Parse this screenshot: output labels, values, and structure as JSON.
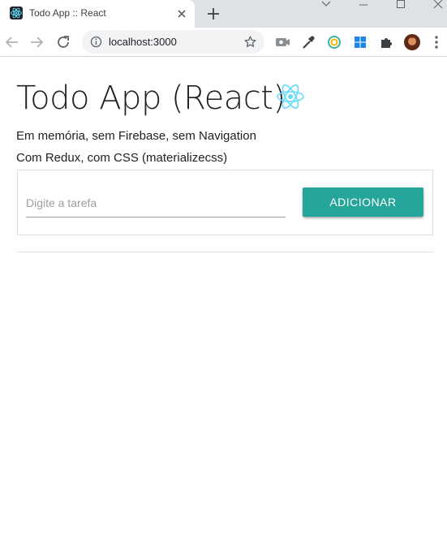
{
  "browser": {
    "tab_title": "Todo App :: React",
    "url": "localhost:3000"
  },
  "page": {
    "title": "Todo App (React)",
    "subtitle_1": "Em memória, sem Firebase, sem Navigation",
    "subtitle_2": "Com Redux, com CSS (materializecss)",
    "input_placeholder": "Digite a tarefa",
    "input_value": "",
    "add_button_label": "ADICIONAR"
  },
  "colors": {
    "accent": "#26a69a",
    "react_logo": "#61dafb",
    "tabstrip": "#dee1e6"
  },
  "icons": [
    "react-favicon-icon",
    "close-tab-icon",
    "new-tab-icon",
    "minimize-icon",
    "maximize-icon",
    "close-window-icon",
    "back-icon",
    "forward-icon",
    "reload-icon",
    "info-icon",
    "bookmark-star-icon",
    "extension-icons",
    "puzzle-icon",
    "avatar",
    "menu-icon",
    "react-logo-icon"
  ]
}
